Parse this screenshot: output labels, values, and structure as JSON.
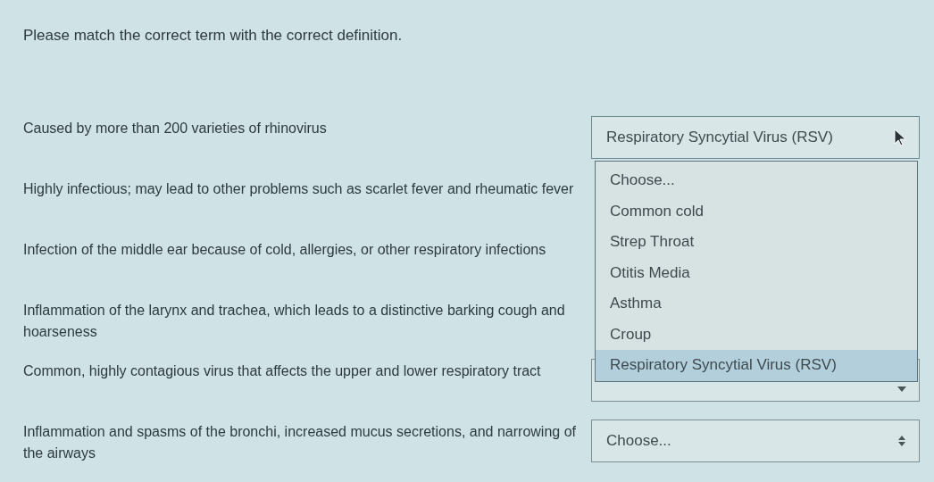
{
  "instruction": "Please match the correct term with the correct definition.",
  "rows": [
    {
      "definition": "Caused by more than 200 varieties of rhinovirus",
      "select": {
        "value": "Respiratory Syncytial Virus (RSV)",
        "open": true,
        "options": [
          {
            "label": "Choose...",
            "selected": false
          },
          {
            "label": "Common cold",
            "selected": false
          },
          {
            "label": "Strep Throat",
            "selected": false
          },
          {
            "label": "Otitis Media",
            "selected": false
          },
          {
            "label": "Asthma",
            "selected": false
          },
          {
            "label": "Croup",
            "selected": false
          },
          {
            "label": "Respiratory Syncytial Virus (RSV)",
            "selected": true
          }
        ]
      }
    },
    {
      "definition": "Highly infectious; may lead to other problems such as scarlet fever and rheumatic fever"
    },
    {
      "definition": "Infection of the middle ear because of cold, allergies, or other respiratory infections"
    },
    {
      "definition": "Inflammation of the larynx and trachea, which leads to a distinctive barking cough and hoarseness"
    },
    {
      "definition": "Common, highly contagious virus that affects the upper and lower respiratory tract",
      "select": {
        "open": false
      }
    },
    {
      "definition": "Inflammation and spasms of the bronchi, increased mucus secretions, and narrowing of the airways",
      "select": {
        "value": "Choose...",
        "open": false
      }
    }
  ]
}
